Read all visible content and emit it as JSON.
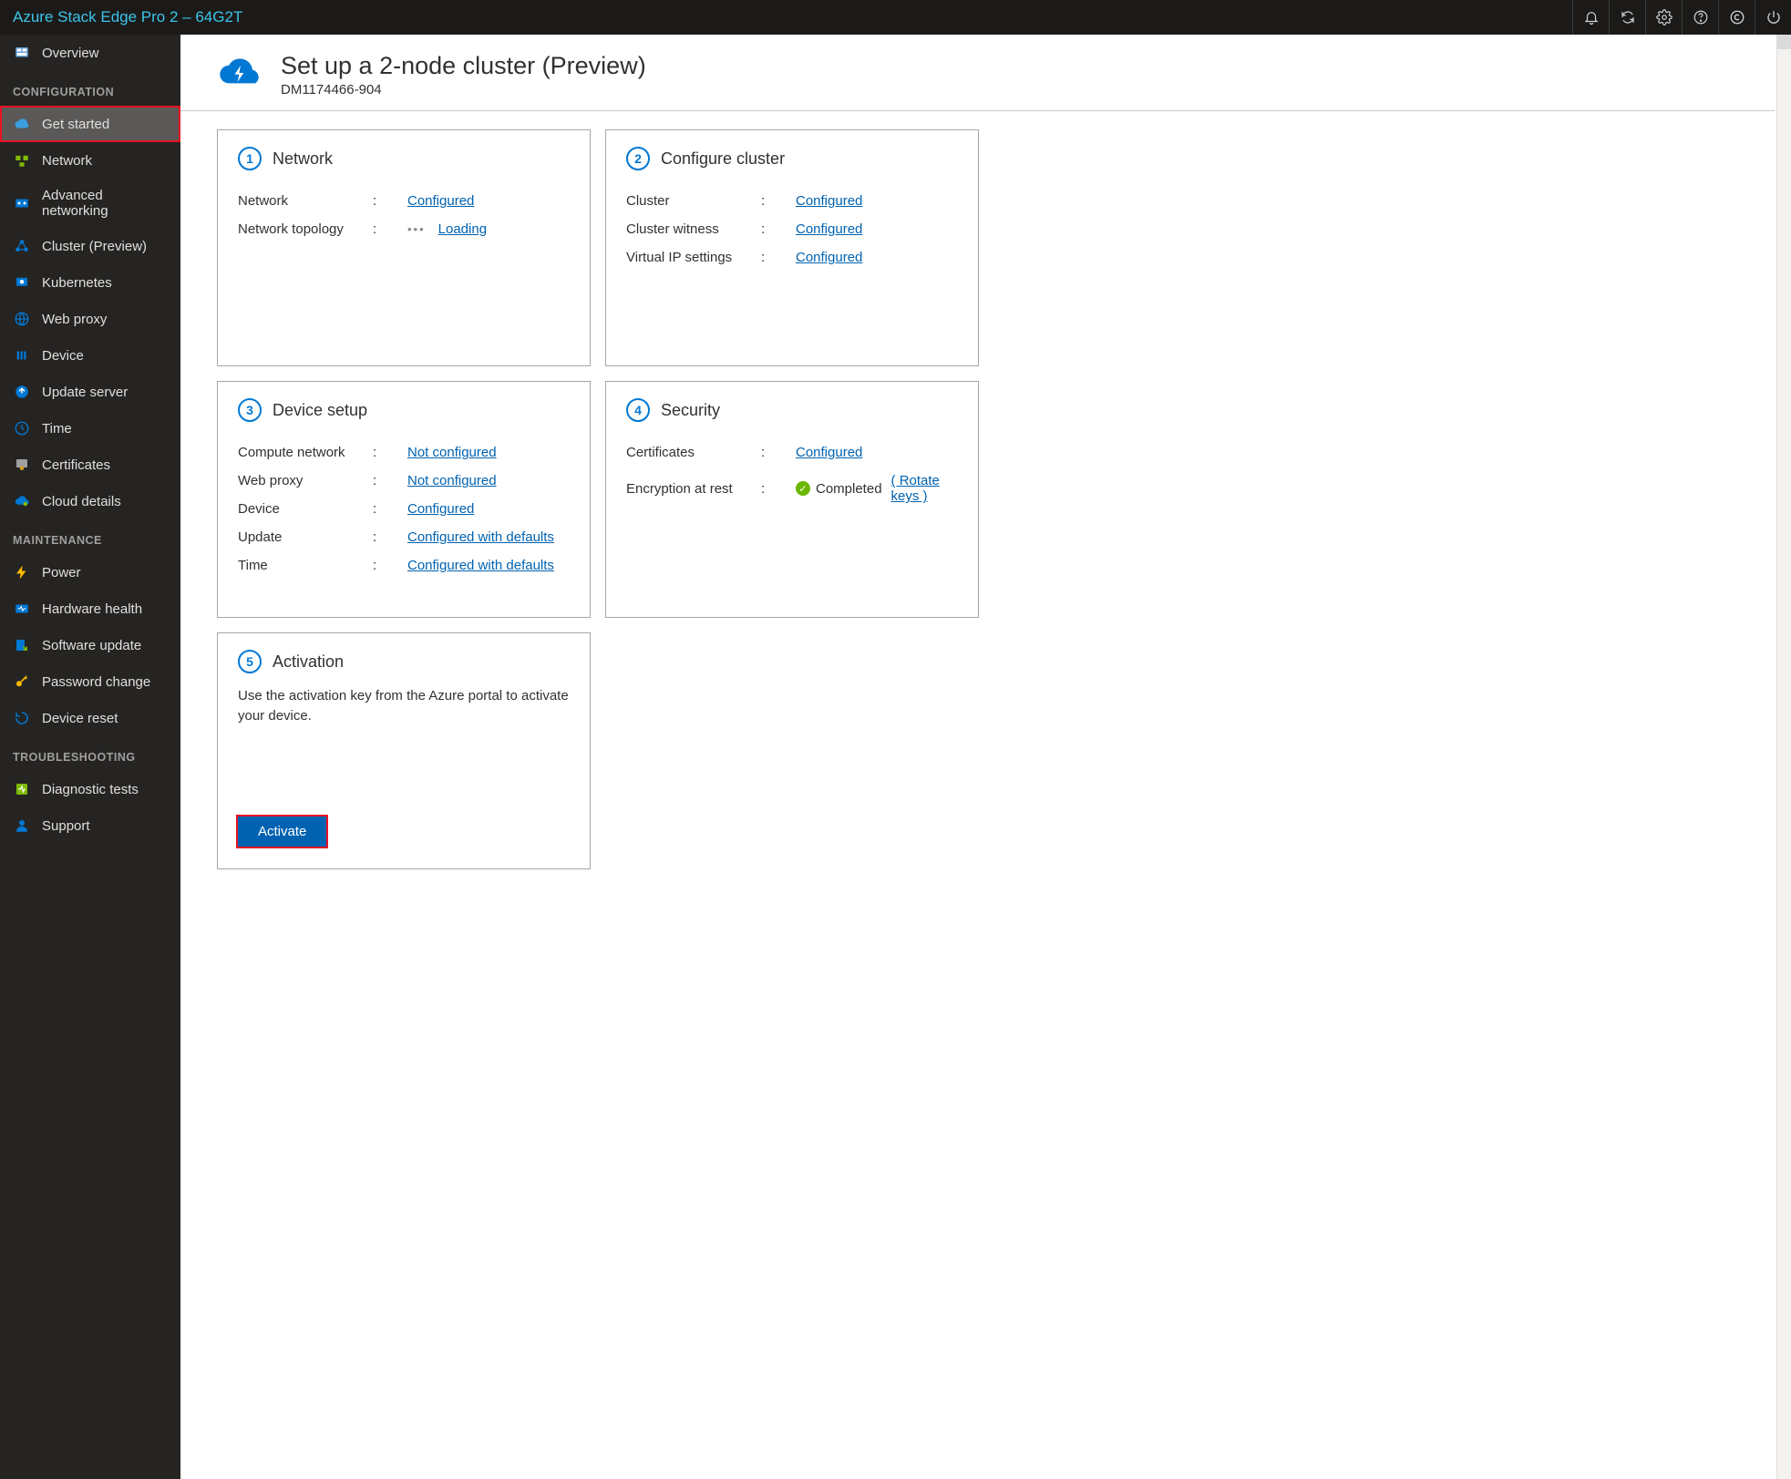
{
  "header": {
    "title": "Azure Stack Edge Pro 2 – 64G2T"
  },
  "sidebar": {
    "overview": "Overview",
    "sections": {
      "configuration": "CONFIGURATION",
      "maintenance": "MAINTENANCE",
      "troubleshooting": "TROUBLESHOOTING"
    },
    "config": {
      "get_started": "Get started",
      "network": "Network",
      "adv_net": "Advanced networking",
      "cluster": "Cluster (Preview)",
      "kubernetes": "Kubernetes",
      "web_proxy": "Web proxy",
      "device": "Device",
      "update_server": "Update server",
      "time": "Time",
      "certificates": "Certificates",
      "cloud_details": "Cloud details"
    },
    "maint": {
      "power": "Power",
      "hw_health": "Hardware health",
      "sw_update": "Software update",
      "pw_change": "Password change",
      "device_reset": "Device reset"
    },
    "trouble": {
      "diagnostics": "Diagnostic tests",
      "support": "Support"
    }
  },
  "page": {
    "title": "Set up a 2-node cluster (Preview)",
    "subtitle": "DM1174466-904"
  },
  "card1": {
    "num": "1",
    "title": "Network",
    "rows": {
      "network_k": "Network",
      "network_v": "Configured",
      "topology_k": "Network topology",
      "topology_v": "Loading"
    }
  },
  "card2": {
    "num": "2",
    "title": "Configure cluster",
    "rows": {
      "cluster_k": "Cluster",
      "cluster_v": "Configured",
      "witness_k": "Cluster witness",
      "witness_v": "Configured",
      "vip_k": "Virtual IP settings",
      "vip_v": "Configured"
    }
  },
  "card3": {
    "num": "3",
    "title": "Device setup",
    "rows": {
      "compute_k": "Compute network",
      "compute_v": "Not configured",
      "proxy_k": "Web proxy",
      "proxy_v": "Not configured",
      "device_k": "Device",
      "device_v": "Configured",
      "update_k": "Update",
      "update_v": "Configured with defaults",
      "time_k": "Time",
      "time_v": "Configured with defaults"
    }
  },
  "card4": {
    "num": "4",
    "title": "Security",
    "rows": {
      "cert_k": "Certificates",
      "cert_v": "Configured",
      "enc_k": "Encryption at rest",
      "enc_v": "Completed",
      "rotate": "( Rotate keys )"
    }
  },
  "card5": {
    "num": "5",
    "title": "Activation",
    "text": "Use the activation key from the Azure portal to activate your device.",
    "button": "Activate"
  }
}
